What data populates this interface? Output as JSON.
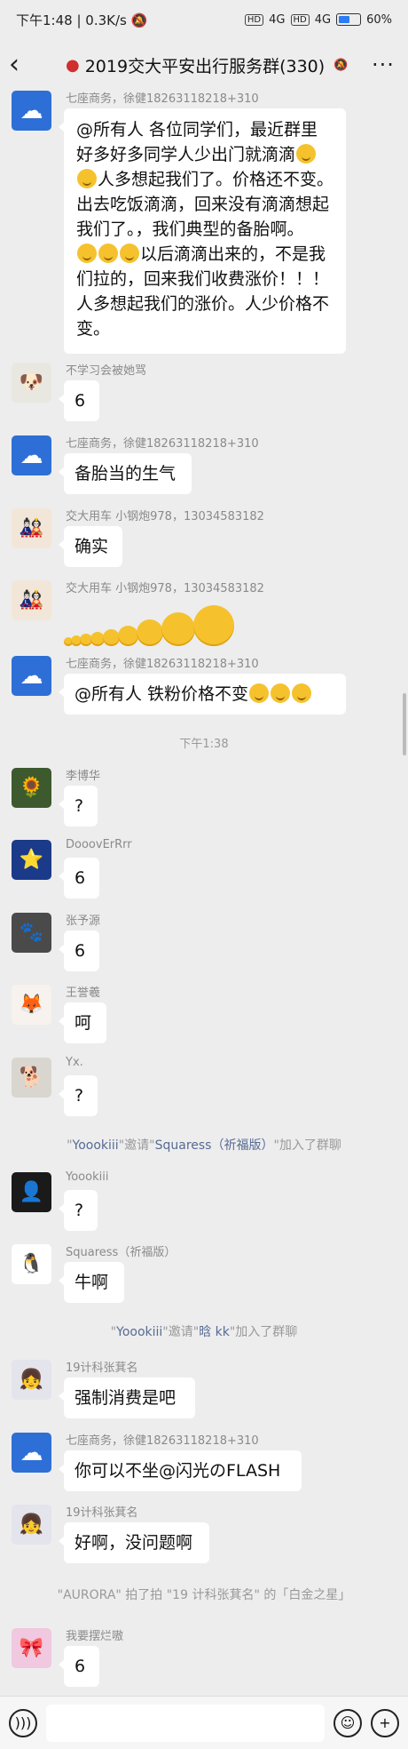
{
  "status": {
    "time": "下午1:48",
    "speed": "0.3K/s",
    "hd": "HD",
    "net": "4G",
    "battery_label": "60%",
    "battery_level": 0.6
  },
  "header": {
    "title": "2019交大平安出行服务群(330)",
    "back_icon": "chevron-left-icon",
    "more_icon": "more-icon"
  },
  "messages": [
    {
      "sender": "七座商务，徐健18263118218+310",
      "lines": [
        "@所有人  各位同学们，最近群里",
        "好多好多同学人少出门就滴滴",
        "人多想起我们了。价格还不变。",
        "出去吃饭滴滴，回来没有滴滴想起",
        "我们了。，我们典型的备胎啊。",
        "以后滴滴出来的，不是我",
        "们拉的，回来我们收费涨价！！！",
        "人多想起我们的涨价。人少价格不",
        "变。"
      ]
    },
    {
      "sender": "不学习会被她骂",
      "text": "6"
    },
    {
      "sender": "七座商务，徐健18263118218+310",
      "text": "备胎当的生气"
    },
    {
      "sender": "交大用车 小钢炮978，13034583182",
      "text": "确实"
    },
    {
      "sender": "交大用车 小钢炮978，13034583182",
      "text": ""
    },
    {
      "sender": "七座商务，徐健18263118218+310",
      "text": "@所有人  铁粉价格不变"
    },
    {
      "sender": "李博华",
      "text": "?"
    },
    {
      "sender": "DooovErRrr",
      "text": "6"
    },
    {
      "sender": "张予源",
      "text": "6"
    },
    {
      "sender": "王誉羲",
      "text": "呵"
    },
    {
      "sender": "Yx.",
      "text": "?"
    },
    {
      "sender": "Yoookiii",
      "text": "?"
    },
    {
      "sender": "Squaress（祈福版）",
      "text": "牛啊"
    },
    {
      "sender": "19计科张萁名",
      "text": "强制消费是吧"
    },
    {
      "sender": "七座商务，徐健18263118218+310",
      "text": "你可以不坐@闪光のFLASH"
    },
    {
      "sender": "19计科张萁名",
      "text": "好啊，没问题啊"
    },
    {
      "sender": "我要摆烂嗷",
      "text": "6"
    }
  ],
  "time_divider": "下午1:38",
  "system": [
    {
      "a": "\"",
      "b": "Yoookiii",
      "c": "\"邀请\"",
      "d": "Squaress（祈福版）",
      "e": "\"加入了群聊"
    },
    {
      "a": "\"",
      "b": "Yoookiii",
      "c": "\"邀请\"",
      "d": "晗 kk",
      "e": "\"加入了群聊"
    }
  ],
  "pat": "\"AURORA\" 拍了拍 \"19 计科张萁名\" 的「白金之星」",
  "input": {
    "voice_icon": "voice-icon",
    "emoji_icon": "emoji-icon",
    "plus_icon": "plus-icon"
  }
}
